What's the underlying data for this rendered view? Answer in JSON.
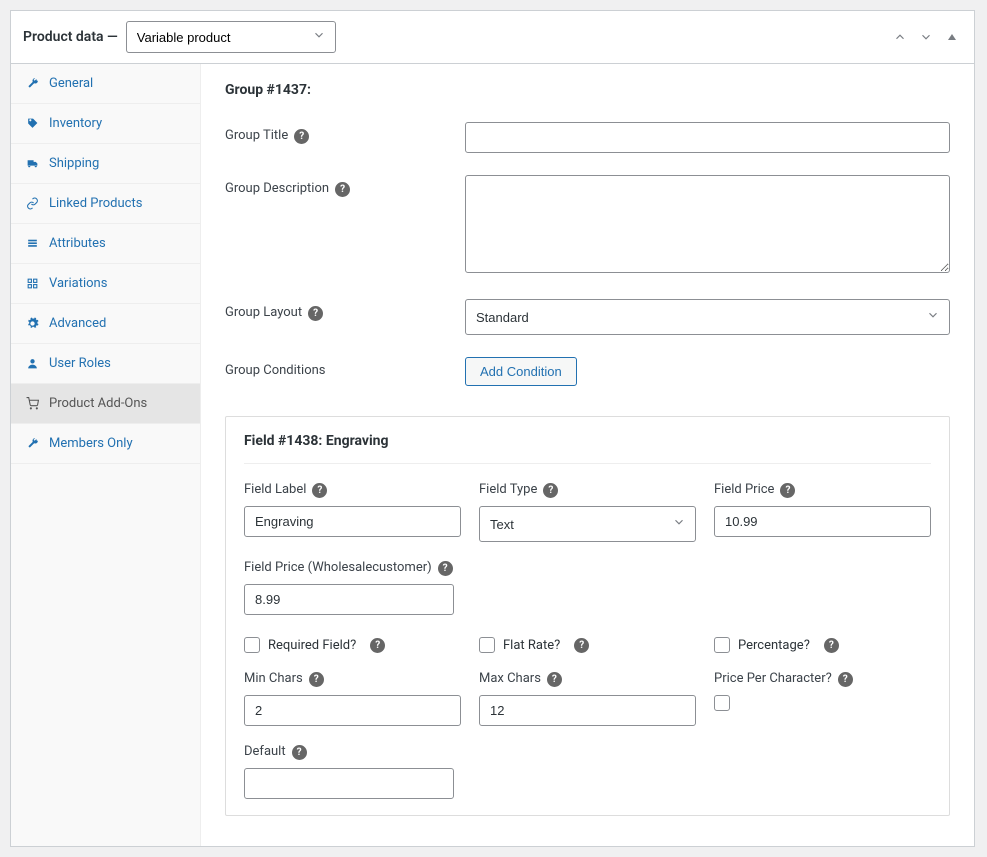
{
  "header": {
    "title": "Product data —",
    "product_type": "Variable product"
  },
  "sidebar": {
    "items": [
      {
        "label": "General",
        "icon": "wrench"
      },
      {
        "label": "Inventory",
        "icon": "tag"
      },
      {
        "label": "Shipping",
        "icon": "truck"
      },
      {
        "label": "Linked Products",
        "icon": "link"
      },
      {
        "label": "Attributes",
        "icon": "list"
      },
      {
        "label": "Variations",
        "icon": "grid"
      },
      {
        "label": "Advanced",
        "icon": "gear"
      },
      {
        "label": "User Roles",
        "icon": "user"
      },
      {
        "label": "Product Add-Ons",
        "icon": "cart"
      },
      {
        "label": "Members Only",
        "icon": "wrench"
      }
    ]
  },
  "group": {
    "heading": "Group #1437:",
    "labels": {
      "title": "Group Title",
      "description": "Group Description",
      "layout": "Group Layout",
      "conditions": "Group Conditions"
    },
    "title_value": "",
    "description_value": "",
    "layout_options": [
      "Standard"
    ],
    "layout_value": "Standard",
    "add_condition_btn": "Add Condition"
  },
  "field": {
    "heading": "Field #1438: Engraving",
    "labels": {
      "field_label": "Field Label",
      "field_type": "Field Type",
      "field_price": "Field Price",
      "wholesale_price": "Field Price (Wholesalecustomer)",
      "required": "Required Field?",
      "flat_rate": "Flat Rate?",
      "percentage": "Percentage?",
      "min_chars": "Min Chars",
      "max_chars": "Max Chars",
      "price_per_char": "Price Per Character?",
      "default": "Default"
    },
    "values": {
      "field_label": "Engraving",
      "field_type": "Text",
      "field_price": "10.99",
      "wholesale_price": "8.99",
      "required": false,
      "flat_rate": false,
      "percentage": false,
      "min_chars": "2",
      "max_chars": "12",
      "price_per_char": false,
      "default": ""
    },
    "field_type_options": [
      "Text"
    ]
  }
}
